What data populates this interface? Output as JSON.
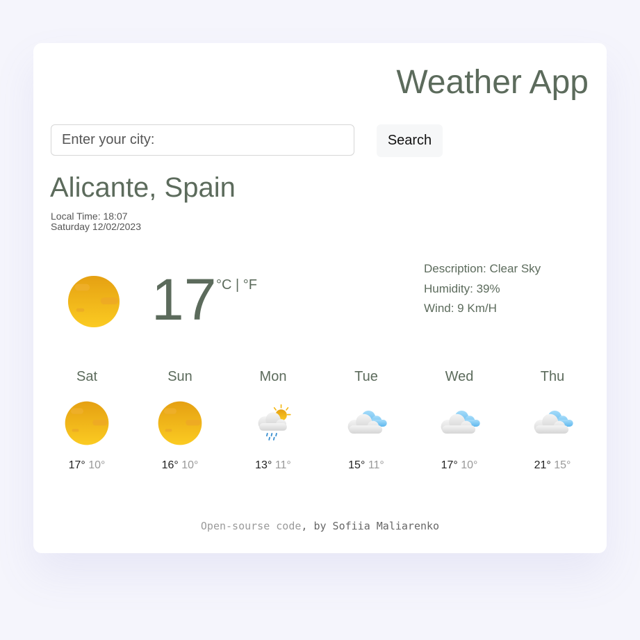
{
  "app": {
    "title": "Weather App"
  },
  "search": {
    "placeholder": "Enter your city:",
    "button_label": "Search"
  },
  "location": {
    "city": "Alicante, Spain",
    "local_time": "Local Time: 18:07",
    "date": "Saturday 12/02/2023"
  },
  "current": {
    "icon": "sun-icon",
    "temperature": "17",
    "unit_celsius": "°C",
    "unit_sep": " | ",
    "unit_fahrenheit": "°F",
    "description": "Description: Clear Sky",
    "humidity": "Humidity: 39%",
    "wind": "Wind: 9 Km/H"
  },
  "forecast": [
    {
      "day": "Sat",
      "icon": "sun-icon",
      "max": "17°",
      "min": "10°"
    },
    {
      "day": "Sun",
      "icon": "sun-icon",
      "max": "16°",
      "min": "10°"
    },
    {
      "day": "Mon",
      "icon": "rain-sun-cloud-icon",
      "max": "13°",
      "min": "11°"
    },
    {
      "day": "Tue",
      "icon": "cloud-icon",
      "max": "15°",
      "min": "11°"
    },
    {
      "day": "Wed",
      "icon": "cloud-icon",
      "max": "17°",
      "min": "10°"
    },
    {
      "day": "Thu",
      "icon": "cloud-icon",
      "max": "21°",
      "min": "15°"
    }
  ],
  "footer": {
    "link_text": "Open-sourse code",
    "author_text": ", by Sofiia Maliarenko"
  },
  "colors": {
    "accent": "#5c6b5c",
    "background": "#f5f5fc",
    "sun": "#f5b814"
  }
}
